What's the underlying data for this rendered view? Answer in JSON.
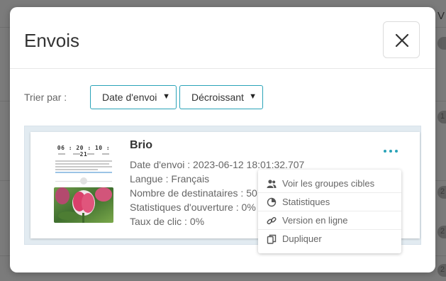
{
  "modal": {
    "title": "Envois",
    "close_icon": "close-icon"
  },
  "sort": {
    "label": "Trier par :",
    "field_value": "Date d'envoi",
    "order_value": "Décroissant"
  },
  "mailing": {
    "name": "Brio",
    "timer": "06 : 20 : 10 : 21",
    "send_date": "Date d'envoi : 2023-06-12 18:01:32.707",
    "language": "Langue : Français",
    "recipients": "Nombre de destinataires : 50",
    "open_stats": "Statistiques d'ouverture : 0%",
    "click_rate": "Taux de clic : 0%"
  },
  "actions_menu": {
    "items": [
      {
        "label": "Voir les groupes cibles",
        "icon": "users-icon"
      },
      {
        "label": "Statistiques",
        "icon": "pie-chart-icon"
      },
      {
        "label": "Version en ligne",
        "icon": "link-icon"
      },
      {
        "label": "Dupliquer",
        "icon": "copy-icon"
      }
    ]
  },
  "background": {
    "header_letter": "V",
    "row_badges": [
      "",
      "1",
      "2",
      "2",
      "2"
    ]
  },
  "colors": {
    "accent": "#2aa3b8",
    "overlay": "#7b7b7b",
    "list_bg": "#e2ebf1"
  }
}
